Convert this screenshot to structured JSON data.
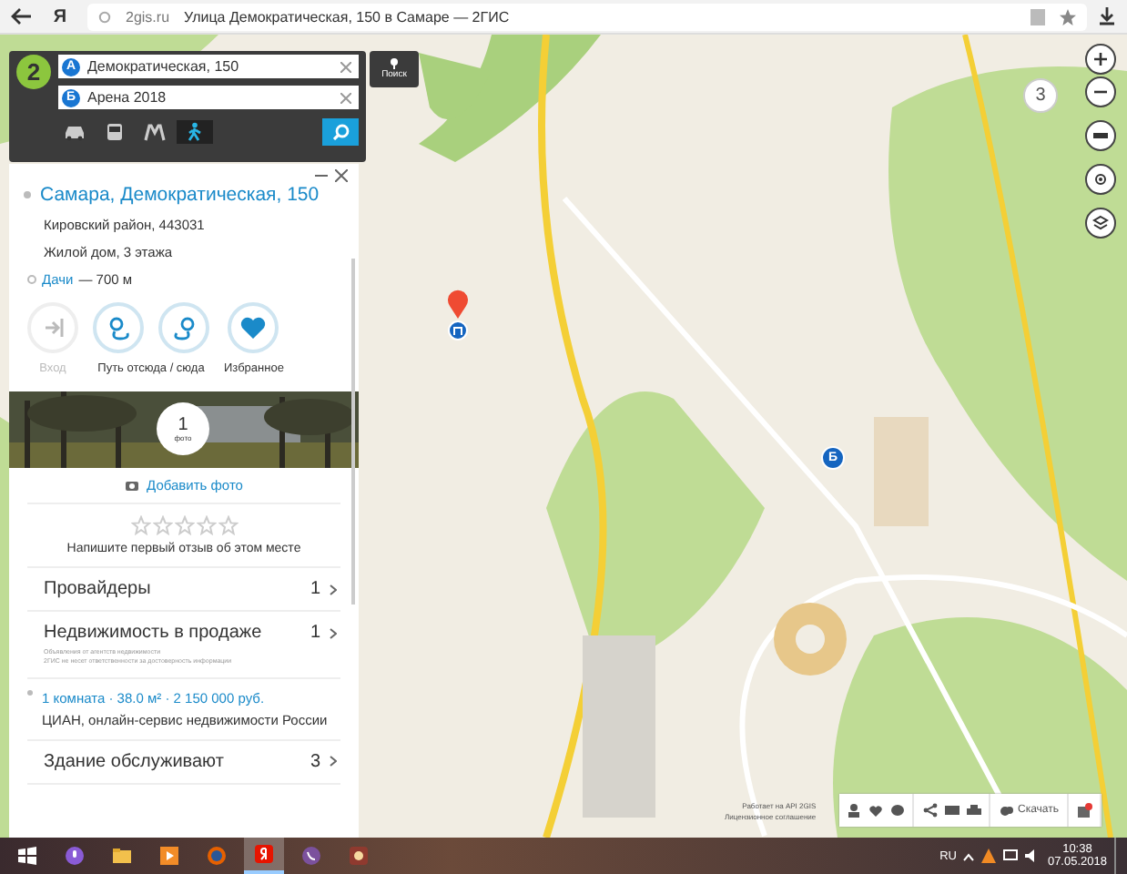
{
  "browser": {
    "logo": "Я",
    "site": "2gis.ru",
    "title": "Улица Демократическая, 150 в Самаре — 2ГИС"
  },
  "route": {
    "logo": "2",
    "points": [
      {
        "badge": "А",
        "value": "Демократическая, 150"
      },
      {
        "badge": "Б",
        "value": "Арена 2018"
      }
    ],
    "modes": [
      {
        "kind": "car",
        "selected": false
      },
      {
        "kind": "bus",
        "selected": false
      },
      {
        "kind": "metro",
        "selected": false
      },
      {
        "kind": "walk",
        "selected": true
      }
    ],
    "search_label": "Поиск"
  },
  "card": {
    "title": "Самара, Демократическая, 150",
    "lines": [
      "Кировский район, 443031",
      "Жилой дом, 3 этажа"
    ],
    "nearby": {
      "name": "Дачи",
      "distance": "— 700 м"
    },
    "actions": [
      {
        "label": "Вход",
        "disabled": true,
        "icons": [
          {
            "kind": "entrance"
          }
        ]
      },
      {
        "label": "Путь отсюда / сюда",
        "disabled": false,
        "icons": [
          {
            "kind": "from"
          },
          {
            "kind": "to"
          }
        ]
      },
      {
        "label": "Избранное",
        "disabled": false,
        "icons": [
          {
            "kind": "favorite"
          }
        ]
      }
    ],
    "photo": {
      "count": "1",
      "caption": "фото"
    },
    "add_photo": "Добавить фото",
    "rating": {
      "stars": 0
    },
    "review_prompt": "Напишите первый отзыв об этом месте",
    "sections": [
      {
        "kind": "category",
        "title": "Провайдеры",
        "count": "1"
      },
      {
        "kind": "category",
        "title": "Недвижимость в продаже",
        "count": "1",
        "note": [
          "Объявления от агентств недвижимости",
          "2ГИС не несет ответственности за достоверность информации"
        ]
      },
      {
        "kind": "offer",
        "title": "1 комната · 38.0 м² · 2 150 000 руб.",
        "source": "ЦИАН, онлайн-сервис недвижимости России"
      },
      {
        "kind": "category",
        "title": "Здание обслуживают",
        "count": "3"
      }
    ]
  },
  "map": {
    "zoom_level": "3",
    "destination_marker": "Б",
    "attribution": [
      "Работает на API 2GIS",
      "Лицензионное соглашение"
    ],
    "download_label": "Скачать"
  },
  "taskbar": {
    "apps": [
      {
        "kind": "folder",
        "selected": false
      },
      {
        "kind": "media",
        "selected": false
      },
      {
        "kind": "firefox",
        "selected": false
      },
      {
        "kind": "yandex",
        "selected": true
      },
      {
        "kind": "viber",
        "selected": false
      },
      {
        "kind": "music",
        "selected": false
      }
    ],
    "language": "RU",
    "time": "10:38",
    "date": "07.05.2018"
  }
}
